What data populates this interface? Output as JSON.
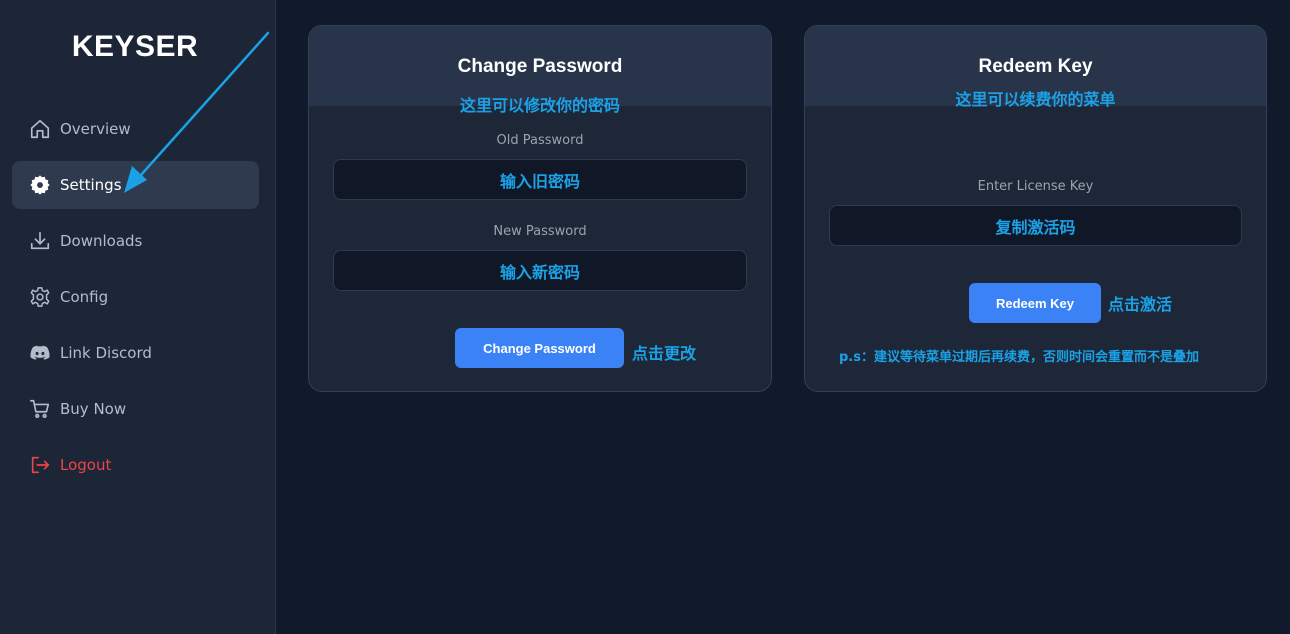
{
  "brand": "KEYSER",
  "sidebar": {
    "items": [
      {
        "label": "Overview",
        "icon": "home-icon"
      },
      {
        "label": "Settings",
        "icon": "cog-icon",
        "active": true
      },
      {
        "label": "Downloads",
        "icon": "download-icon"
      },
      {
        "label": "Config",
        "icon": "gear-icon"
      },
      {
        "label": "Link Discord",
        "icon": "discord-icon"
      },
      {
        "label": "Buy Now",
        "icon": "cart-icon"
      },
      {
        "label": "Logout",
        "icon": "logout-icon"
      }
    ]
  },
  "change_password": {
    "title": "Change Password",
    "note": "这里可以修改你的密码",
    "old_label": "Old Password",
    "old_value": "输入旧密码",
    "new_label": "New Password",
    "new_value": "输入新密码",
    "button": "Change Password",
    "hint": "点击更改"
  },
  "redeem": {
    "title": "Redeem Key",
    "note": "这里可以续费你的菜单",
    "license_label": "Enter License Key",
    "license_value": "复制激活码",
    "button": "Redeem Key",
    "hint": "点击激活",
    "ps": "p.s：建议等待菜单过期后再续费，否则时间会重置而不是叠加"
  },
  "colors": {
    "background": "#111a2b",
    "sidebar": "#1c2637",
    "accent": "#3b82f6",
    "annotation": "#1ba1e6",
    "logout": "#ef4444"
  }
}
